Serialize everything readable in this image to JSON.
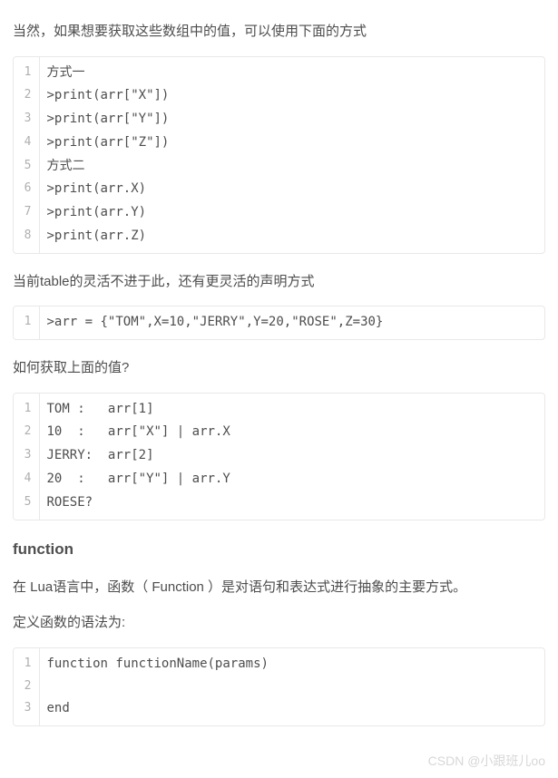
{
  "para1": "当然，如果想要获取这些数组中的值，可以使用下面的方式",
  "code1": {
    "lines": [
      "方式一",
      ">print(arr[\"X\"])",
      ">print(arr[\"Y\"])",
      ">print(arr[\"Z\"])",
      "方式二",
      ">print(arr.X)",
      ">print(arr.Y)",
      ">print(arr.Z)"
    ]
  },
  "para2": "当前table的灵活不进于此，还有更灵活的声明方式",
  "code2": {
    "lines": [
      ">arr = {\"TOM\",X=10,\"JERRY\",Y=20,\"ROSE\",Z=30}"
    ]
  },
  "para3": "如何获取上面的值?",
  "code3": {
    "lines": [
      "TOM :   arr[1]",
      "10  :   arr[\"X\"] | arr.X",
      "JERRY:  arr[2]",
      "20  :   arr[\"Y\"] | arr.Y",
      "ROESE?"
    ]
  },
  "heading1": "function",
  "para4": "在 Lua语言中，函数（ Function ）是对语句和表达式进行抽象的主要方式。",
  "para5": "定义函数的语法为:",
  "code4": {
    "lines": [
      "function functionName(params)",
      "",
      "end"
    ]
  },
  "watermark": "CSDN @小跟班儿oo"
}
